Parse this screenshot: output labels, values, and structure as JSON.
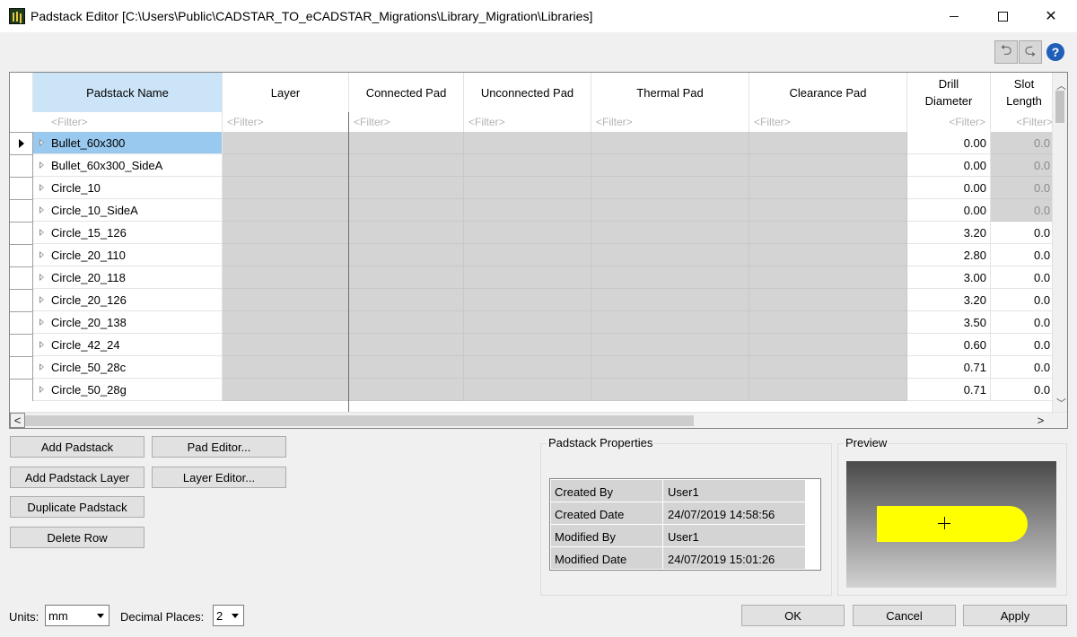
{
  "window": {
    "title": "Padstack Editor [C:\\Users\\Public\\CADSTAR_TO_eCADSTAR_Migrations\\Library_Migration\\Libraries]",
    "minimize_glyph": "",
    "close_glyph": "✕"
  },
  "toolbar": {
    "undo_glyph": "⮌",
    "redo_glyph": "⮎",
    "help_glyph": "?"
  },
  "grid": {
    "columns": [
      "Padstack Name",
      "Layer",
      "Connected Pad",
      "Unconnected Pad",
      "Thermal Pad",
      "Clearance Pad",
      "Drill Diameter",
      "Slot Length"
    ],
    "filter_placeholder": "<Filter>",
    "rows": [
      {
        "name": "Bullet_60x300",
        "drill": "0.00",
        "slot": "0.0",
        "slot_disabled": true,
        "selected": true
      },
      {
        "name": "Bullet_60x300_SideA",
        "drill": "0.00",
        "slot": "0.0",
        "slot_disabled": true
      },
      {
        "name": "Circle_10",
        "drill": "0.00",
        "slot": "0.0",
        "slot_disabled": true
      },
      {
        "name": "Circle_10_SideA",
        "drill": "0.00",
        "slot": "0.0",
        "slot_disabled": true
      },
      {
        "name": "Circle_15_126",
        "drill": "3.20",
        "slot": "0.0"
      },
      {
        "name": "Circle_20_110",
        "drill": "2.80",
        "slot": "0.0"
      },
      {
        "name": "Circle_20_118",
        "drill": "3.00",
        "slot": "0.0"
      },
      {
        "name": "Circle_20_126",
        "drill": "3.20",
        "slot": "0.0"
      },
      {
        "name": "Circle_20_138",
        "drill": "3.50",
        "slot": "0.0"
      },
      {
        "name": "Circle_42_24",
        "drill": "0.60",
        "slot": "0.0"
      },
      {
        "name": "Circle_50_28c",
        "drill": "0.71",
        "slot": "0.0"
      },
      {
        "name": "Circle_50_28g",
        "drill": "0.71",
        "slot": "0.0"
      }
    ],
    "scroll": {
      "left": "<",
      "right": ">",
      "up": "^",
      "down": "v"
    }
  },
  "buttons": {
    "add_padstack": "Add Padstack",
    "add_padstack_layer": "Add Padstack Layer",
    "duplicate_padstack": "Duplicate Padstack",
    "delete_row": "Delete Row",
    "pad_editor": "Pad Editor...",
    "layer_editor": "Layer Editor...",
    "ok": "OK",
    "cancel": "Cancel",
    "apply": "Apply"
  },
  "properties": {
    "title": "Padstack Properties",
    "items": [
      {
        "key": "Created By",
        "value": "User1"
      },
      {
        "key": "Created Date",
        "value": "24/07/2019 14:58:56"
      },
      {
        "key": "Modified By",
        "value": "User1"
      },
      {
        "key": "Modified Date",
        "value": "24/07/2019 15:01:26"
      }
    ]
  },
  "preview": {
    "title": "Preview",
    "pad_color": "#ffff00"
  },
  "footer": {
    "units_label": "Units:",
    "units_value": "mm",
    "decimal_label": "Decimal Places:",
    "decimal_value": "2"
  }
}
